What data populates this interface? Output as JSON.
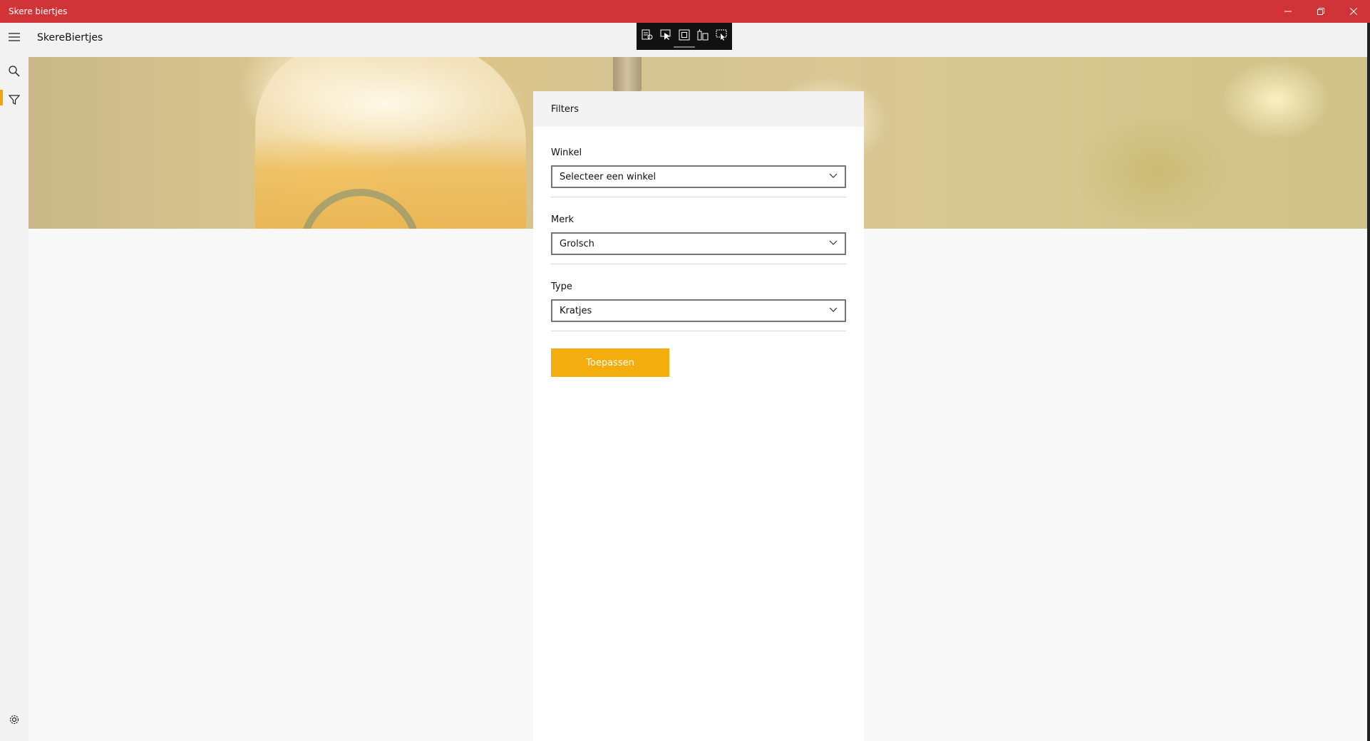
{
  "window": {
    "title": "Skere biertjes",
    "accent_color": "#d13438",
    "buttons": [
      "minimize-icon",
      "restore-icon",
      "close-icon"
    ]
  },
  "app": {
    "title": "SkereBiertjes"
  },
  "rail": {
    "items": [
      {
        "name": "search",
        "icon": "search-icon"
      },
      {
        "name": "filter",
        "icon": "filter-icon",
        "selected": true
      }
    ],
    "footer_icon": "gear-icon",
    "indicator_color": "#f0a30a"
  },
  "devtools": {
    "icons": [
      "live-visual-tree-icon",
      "select-element-icon",
      "display-layout-adorners-icon",
      "track-focused-element-icon",
      "hot-reload-icon"
    ]
  },
  "filters": {
    "header": "Filters",
    "winkel": {
      "label": "Winkel",
      "value": "Selecteer een winkel"
    },
    "merk": {
      "label": "Merk",
      "value": "Grolsch"
    },
    "type": {
      "label": "Type",
      "value": "Kratjes"
    },
    "apply_label": "Toepassen",
    "apply_color": "#f4ad0f"
  }
}
